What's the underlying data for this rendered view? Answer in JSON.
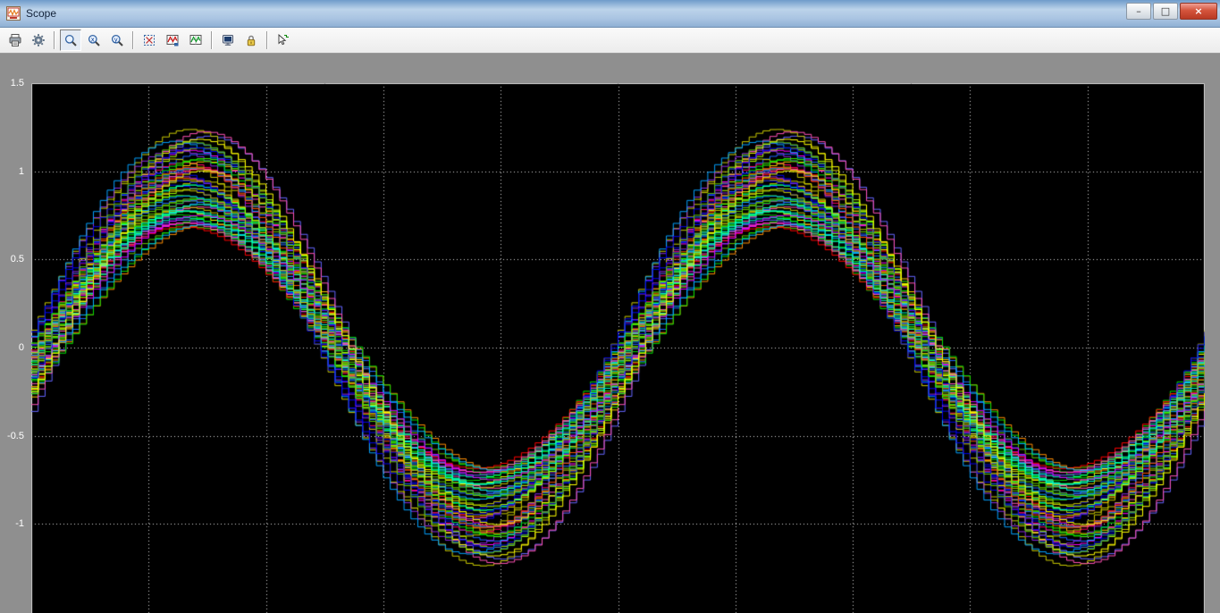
{
  "window": {
    "title": "Scope",
    "app_icon": "simulink-scope-icon",
    "controls": [
      {
        "name": "minimize",
        "glyph": "–"
      },
      {
        "name": "maximize",
        "glyph": "□"
      },
      {
        "name": "close",
        "glyph": "×"
      }
    ]
  },
  "toolbar": {
    "buttons": [
      {
        "name": "print",
        "tooltip": "Print"
      },
      {
        "name": "parameters",
        "tooltip": "Parameters"
      },
      {
        "name": "zoom",
        "tooltip": "Zoom",
        "pressed": true
      },
      {
        "name": "zoom-x",
        "tooltip": "Zoom X-axis"
      },
      {
        "name": "zoom-y",
        "tooltip": "Zoom Y-axis"
      },
      {
        "name": "autoscale",
        "tooltip": "Autoscale"
      },
      {
        "name": "save-axes",
        "tooltip": "Save current axes settings"
      },
      {
        "name": "restore-axes",
        "tooltip": "Restore saved axes settings"
      },
      {
        "name": "floating-scope",
        "tooltip": "Floating scope"
      },
      {
        "name": "lock-axes",
        "tooltip": "Lock/Unlock axes selection"
      },
      {
        "name": "signal-selection",
        "tooltip": "Signal selection"
      }
    ]
  },
  "chart_data": {
    "type": "line",
    "title": "",
    "xlabel": "",
    "ylabel": "",
    "background": "#000000",
    "grid_color": "#ffffff",
    "grid": true,
    "legend": false,
    "yticks": [
      1.5,
      1,
      0.5,
      0,
      -0.5,
      -1
    ],
    "ylim": [
      -1.52,
      1.5
    ],
    "x_gridline_count": 9,
    "signal": {
      "shape": "sine",
      "render": "zero-order-hold staircase",
      "periods_visible": 2,
      "base_phase_rad": -0.125,
      "amplitude_range": [
        0.68,
        1.24
      ],
      "phase_jitter_rad": 0.22,
      "num_traces": 60,
      "samples_per_width": 170,
      "seed": 42,
      "peak_value_approx": 1.25,
      "trough_value_approx": -1.2
    },
    "palette": [
      "#ff00ff",
      "#d400ff",
      "#8a2be2",
      "#0000ee",
      "#1e64ff",
      "#00a0ff",
      "#00e5ff",
      "#00ffc8",
      "#00e000",
      "#3cff00",
      "#aaff00",
      "#ffff00",
      "#ffc800",
      "#ff8c00",
      "#ff5000",
      "#ff0000",
      "#ff0064",
      "#ff50b4",
      "#c80064",
      "#00c8a0",
      "#64c800",
      "#c8c800",
      "#6464ff",
      "#00b4ff"
    ]
  }
}
